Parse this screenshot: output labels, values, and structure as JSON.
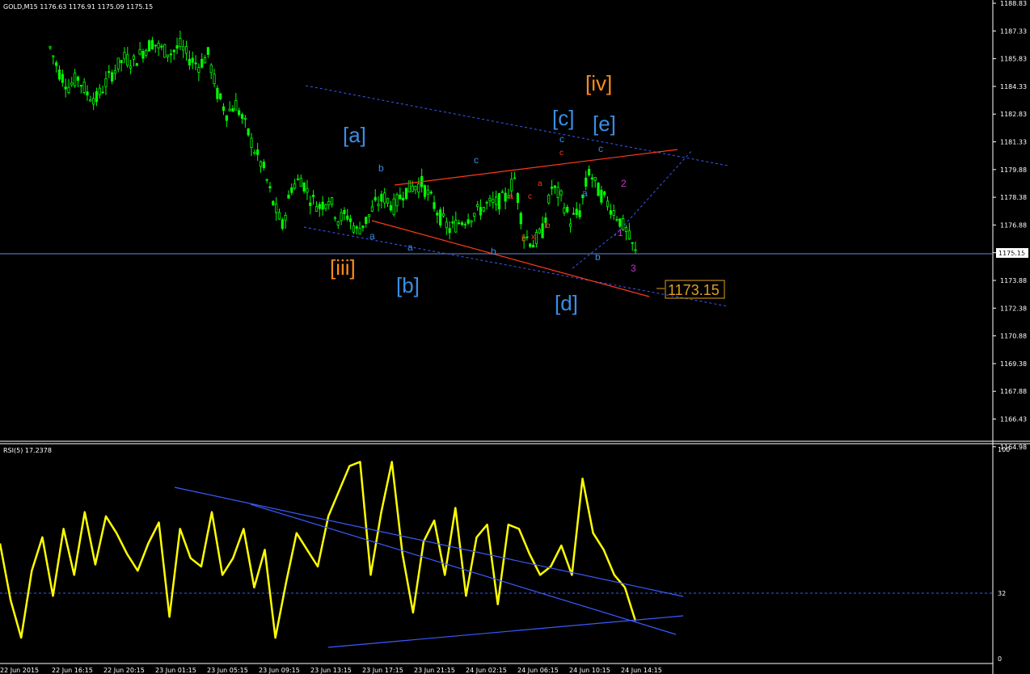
{
  "main_panel": {
    "symbol_info": "GOLD,M15 1176.63 1176.91 1175.09 1175.15",
    "price_axis_ticks": [
      "1188.83",
      "1187.33",
      "1185.83",
      "1184.33",
      "1182.83",
      "1181.33",
      "1179.88",
      "1178.38",
      "1176.88",
      "1175.38",
      "1173.88",
      "1172.38",
      "1170.88",
      "1169.38",
      "1167.88",
      "1166.43",
      "1164.98"
    ],
    "current_price_label": "1175.15",
    "target_price_label": "1173.15",
    "wave_labels": [
      {
        "text": "[iii]",
        "color": "#ff8c1a",
        "size": "big"
      },
      {
        "text": "[iv]",
        "color": "#ff8c1a",
        "size": "big"
      },
      {
        "text": "[a]",
        "color": "#3a8ee6",
        "size": "big"
      },
      {
        "text": "[b]",
        "color": "#3a8ee6",
        "size": "big"
      },
      {
        "text": "[c]",
        "color": "#3a8ee6",
        "size": "big"
      },
      {
        "text": "[d]",
        "color": "#3a8ee6",
        "size": "big"
      },
      {
        "text": "[e]",
        "color": "#3a8ee6",
        "size": "big"
      },
      {
        "text": "a",
        "color": "#3a8ee6",
        "size": "sm"
      },
      {
        "text": "b",
        "color": "#3a8ee6",
        "size": "sm"
      },
      {
        "text": "c",
        "color": "#3a8ee6",
        "size": "sm"
      },
      {
        "text": "a",
        "color": "#3a8ee6",
        "size": "sm"
      },
      {
        "text": "b",
        "color": "#3a8ee6",
        "size": "sm"
      },
      {
        "text": "c",
        "color": "#3a8ee6",
        "size": "sm"
      },
      {
        "text": "a",
        "color": "#3a8ee6",
        "size": "sm"
      },
      {
        "text": "b",
        "color": "#3a8ee6",
        "size": "sm"
      },
      {
        "text": "c",
        "color": "#3a8ee6",
        "size": "sm"
      },
      {
        "text": "c",
        "color": "#ff3a1a",
        "size": "xs"
      },
      {
        "text": "a",
        "color": "#ff3a1a",
        "size": "xs"
      },
      {
        "text": "c",
        "color": "#ff3a1a",
        "size": "xs"
      },
      {
        "text": "a",
        "color": "#ff3a1a",
        "size": "xs"
      },
      {
        "text": "b",
        "color": "#ff3a1a",
        "size": "xs"
      },
      {
        "text": "b",
        "color": "#ff3a1a",
        "size": "xs"
      },
      {
        "text": "x",
        "color": "#ff3a1a",
        "size": "xs"
      },
      {
        "text": "1",
        "color": "#cc33cc",
        "size": "sm"
      },
      {
        "text": "2",
        "color": "#cc33cc",
        "size": "sm"
      },
      {
        "text": "3",
        "color": "#cc33cc",
        "size": "sm"
      }
    ]
  },
  "rsi_panel": {
    "label": "RSI(5) 17.2378",
    "axis_ticks": [
      "100",
      "32",
      "0"
    ]
  },
  "time_axis": [
    "22 Jun 2015",
    "22 Jun 16:15",
    "22 Jun 20:15",
    "23 Jun 01:15",
    "23 Jun 05:15",
    "23 Jun 09:15",
    "23 Jun 13:15",
    "23 Jun 17:15",
    "23 Jun 21:15",
    "24 Jun 02:15",
    "24 Jun 06:15",
    "24 Jun 10:15",
    "24 Jun 14:15"
  ],
  "colors": {
    "background": "#000000",
    "candle": "#00ff00",
    "rsi_line": "#ffff00",
    "channel_blue": "#3a5aff",
    "channel_red": "#ff3a1a",
    "grid_text": "#ffffff",
    "target_box": "#e0a020"
  },
  "chart_data": [
    {
      "type": "candlestick",
      "title": "GOLD,M15",
      "ylim": [
        1164.5,
        1189.5
      ],
      "series": [
        {
          "name": "GOLD,M15",
          "values": [
            1186.8,
            1185.4,
            1184.6,
            1185.1,
            1184.2,
            1183.9,
            1184.8,
            1185.6,
            1186.2,
            1186.0,
            1186.6,
            1187.1,
            1186.7,
            1186.5,
            1186.9,
            1186.2,
            1185.8,
            1186.4,
            1184.2,
            1183.1,
            1183.6,
            1182.4,
            1181.0,
            1179.9,
            1178.0,
            1176.7,
            1178.9,
            1179.4,
            1178.3,
            1177.8,
            1178.3,
            1177.1,
            1177.3,
            1176.4,
            1177.0,
            1177.9,
            1178.3,
            1177.8,
            1178.6,
            1178.9,
            1179.1,
            1178.2,
            1177.2,
            1176.5,
            1176.9,
            1177.2,
            1177.5,
            1177.9,
            1178.0,
            1178.3,
            1179.4,
            1176.2,
            1175.7,
            1176.4,
            1178.9,
            1178.3,
            1177.0,
            1177.5,
            1179.8,
            1178.7,
            1178.0,
            1177.3,
            1176.4,
            1175.15
          ]
        }
      ]
    },
    {
      "type": "line",
      "title": "RSI(5)",
      "ylim": [
        0,
        100
      ],
      "series": [
        {
          "name": "RSI(5)",
          "values": [
            55,
            28,
            10,
            42,
            58,
            30,
            62,
            40,
            70,
            45,
            68,
            60,
            50,
            42,
            55,
            65,
            20,
            62,
            48,
            44,
            70,
            40,
            48,
            62,
            34,
            52,
            10,
            36,
            60,
            52,
            44,
            68,
            80,
            92,
            94,
            40,
            70,
            94,
            50,
            22,
            56,
            66,
            40,
            72,
            30,
            58,
            64,
            26,
            64,
            62,
            50,
            40,
            44,
            54,
            40,
            86,
            60,
            52,
            40,
            34,
            18
          ]
        }
      ]
    }
  ]
}
